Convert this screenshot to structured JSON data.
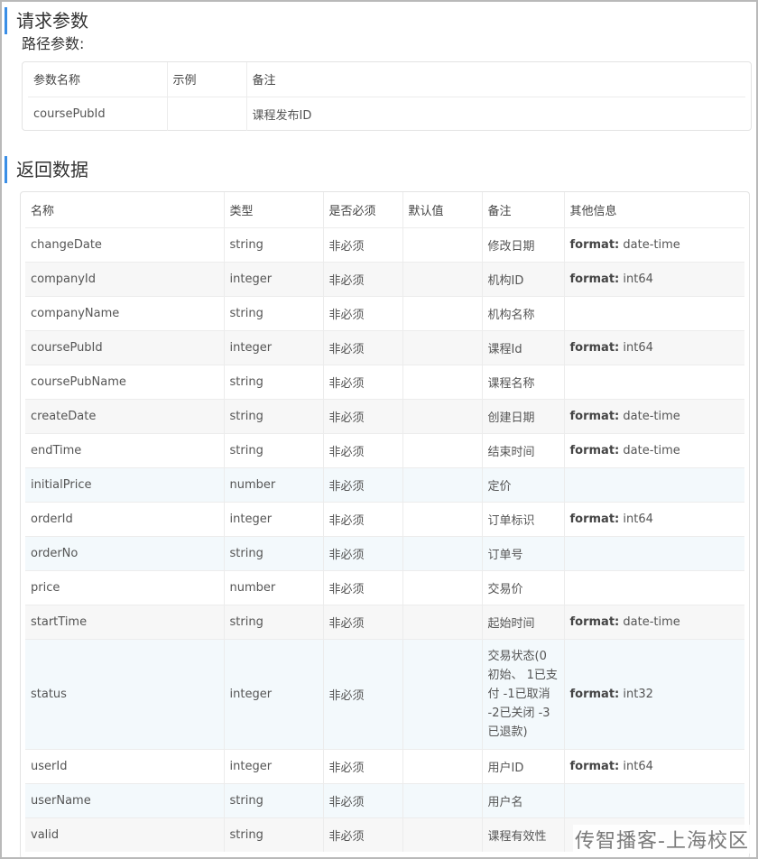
{
  "request": {
    "title": "请求参数",
    "path_title": "路径参数:",
    "headers": [
      "参数名称",
      "示例",
      "备注"
    ],
    "rows": [
      {
        "name": "coursePubId",
        "example": "",
        "remark": "课程发布ID"
      }
    ]
  },
  "response": {
    "title": "返回数据",
    "headers": [
      "名称",
      "类型",
      "是否必须",
      "默认值",
      "备注",
      "其他信息"
    ],
    "format_key": "format:",
    "rows": [
      {
        "name": "changeDate",
        "type": "string",
        "required": "非必须",
        "default": "",
        "remark": "修改日期",
        "format": "date-time"
      },
      {
        "name": "companyId",
        "type": "integer",
        "required": "非必须",
        "default": "",
        "remark": "机构ID",
        "format": "int64"
      },
      {
        "name": "companyName",
        "type": "string",
        "required": "非必须",
        "default": "",
        "remark": "机构名称",
        "format": ""
      },
      {
        "name": "coursePubId",
        "type": "integer",
        "required": "非必须",
        "default": "",
        "remark": "课程Id",
        "format": "int64"
      },
      {
        "name": "coursePubName",
        "type": "string",
        "required": "非必须",
        "default": "",
        "remark": "课程名称",
        "format": ""
      },
      {
        "name": "createDate",
        "type": "string",
        "required": "非必须",
        "default": "",
        "remark": "创建日期",
        "format": "date-time"
      },
      {
        "name": "endTime",
        "type": "string",
        "required": "非必须",
        "default": "",
        "remark": "结束时间",
        "format": "date-time"
      },
      {
        "name": "initialPrice",
        "type": "number",
        "required": "非必须",
        "default": "",
        "remark": "定价",
        "format": ""
      },
      {
        "name": "orderId",
        "type": "integer",
        "required": "非必须",
        "default": "",
        "remark": "订单标识",
        "format": "int64"
      },
      {
        "name": "orderNo",
        "type": "string",
        "required": "非必须",
        "default": "",
        "remark": "订单号",
        "format": ""
      },
      {
        "name": "price",
        "type": "number",
        "required": "非必须",
        "default": "",
        "remark": "交易价",
        "format": ""
      },
      {
        "name": "startTime",
        "type": "string",
        "required": "非必须",
        "default": "",
        "remark": "起始时间",
        "format": "date-time"
      },
      {
        "name": "status",
        "type": "integer",
        "required": "非必须",
        "default": "",
        "remark": "交易状态(0初始、 1已支付 -1已取消 -2已关闭 -3已退款)",
        "format": "int32"
      },
      {
        "name": "userId",
        "type": "integer",
        "required": "非必须",
        "default": "",
        "remark": "用户ID",
        "format": "int64"
      },
      {
        "name": "userName",
        "type": "string",
        "required": "非必须",
        "default": "",
        "remark": "用户名",
        "format": ""
      },
      {
        "name": "valid",
        "type": "string",
        "required": "非必须",
        "default": "",
        "remark": "课程有效性",
        "format": ""
      }
    ]
  },
  "watermark": "传智播客-上海校区"
}
